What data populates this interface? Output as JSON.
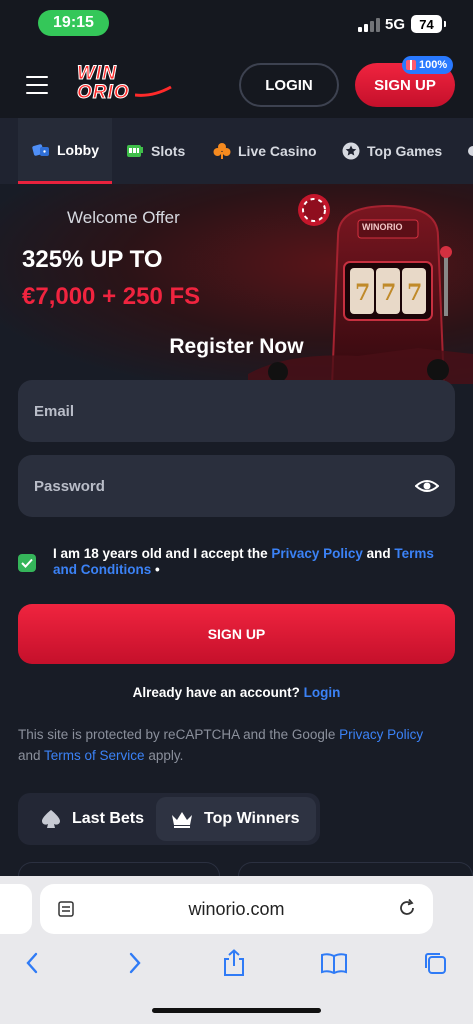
{
  "status_bar": {
    "time": "19:15",
    "network": "5G",
    "battery": "74"
  },
  "header": {
    "logo_line1": "WIN",
    "logo_line2": "ORIO",
    "login_label": "LOGIN",
    "signup_label": "SIGN UP",
    "badge": "100%"
  },
  "tabs": [
    {
      "label": "Lobby",
      "icon": "dice-icon",
      "active": true
    },
    {
      "label": "Slots",
      "icon": "slot-machine-icon",
      "active": false
    },
    {
      "label": "Live Casino",
      "icon": "club-icon",
      "active": false
    },
    {
      "label": "Top Games",
      "icon": "star-icon",
      "active": false
    }
  ],
  "hero": {
    "welcome": "Welcome Offer",
    "offer_line1": "325% UP TO",
    "offer_line2": "€7,000 + 250 FS",
    "machine_brand": "WINORIO",
    "register_title": "Register Now"
  },
  "form": {
    "email_placeholder": "Email",
    "password_placeholder": "Password",
    "terms_prefix": "I am 18 years old and I accept the ",
    "privacy_link": "Privacy Policy",
    "terms_and": " and ",
    "terms_link": "Terms and Conditions",
    "terms_suffix": " •",
    "signup_label": "SIGN UP",
    "have_account": "Already have an account? ",
    "login_link": "Login"
  },
  "recaptcha": {
    "text1": "This site is protected by reCAPTCHA and the Google ",
    "privacy_link": "Privacy Policy",
    "text2": " and ",
    "terms_link": "Terms of Service",
    "text3": " apply."
  },
  "bets": [
    {
      "label": "Last Bets",
      "icon": "spade-icon",
      "active": false
    },
    {
      "label": "Top Winners",
      "icon": "crown-icon",
      "active": true
    }
  ],
  "browser": {
    "url": "winorio.com"
  },
  "colors": {
    "accent": "#f0243f",
    "link": "#3b82f6",
    "background": "#181c26",
    "check": "#35b55a"
  }
}
